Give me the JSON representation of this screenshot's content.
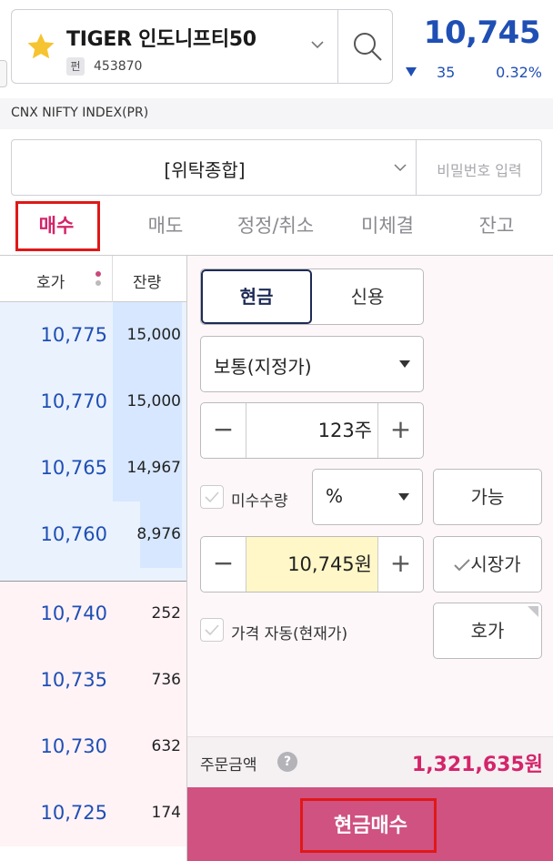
{
  "stock": {
    "name": "TIGER 인도니프티50",
    "badge": "펀",
    "code": "453870",
    "price": "10,745",
    "change": "35",
    "change_rate": "0.32%",
    "index_name": "CNX NIFTY INDEX(PR)"
  },
  "account": {
    "label": "[위탁종합]",
    "password_placeholder": "비밀번호 입력"
  },
  "tabs": [
    "매수",
    "매도",
    "정정/취소",
    "미체결",
    "잔고"
  ],
  "orderbook": {
    "header_price": "호가",
    "header_qty": "잔량",
    "asks": [
      {
        "price": "10,775",
        "qty": "15,000",
        "fill": 1.0
      },
      {
        "price": "10,770",
        "qty": "15,000",
        "fill": 1.0
      },
      {
        "price": "10,765",
        "qty": "14,967",
        "fill": 1.0
      },
      {
        "price": "10,760",
        "qty": "8,976",
        "fill": 0.6
      }
    ],
    "bids": [
      {
        "price": "10,740",
        "qty": "252"
      },
      {
        "price": "10,735",
        "qty": "736"
      },
      {
        "price": "10,730",
        "qty": "632"
      },
      {
        "price": "10,725",
        "qty": "174"
      }
    ]
  },
  "order": {
    "seg_cash": "현금",
    "seg_credit": "신용",
    "order_type": "보통(지정가)",
    "quantity": "123주",
    "odd_lot_label": "미수수량",
    "percent_label": "%",
    "available_btn": "가능",
    "price": "10,745원",
    "market_btn": "시장가",
    "auto_price_label": "가격 자동(현재가)",
    "quote_btn": "호가",
    "amount_label": "주문금액",
    "amount_value": "1,321,635원",
    "submit_label": "현금매수"
  },
  "colors": {
    "accent_blue": "#1f4fb4",
    "accent_pink": "#d4246a",
    "buy_bar": "#cf5281",
    "highlight_red": "#e01818"
  }
}
